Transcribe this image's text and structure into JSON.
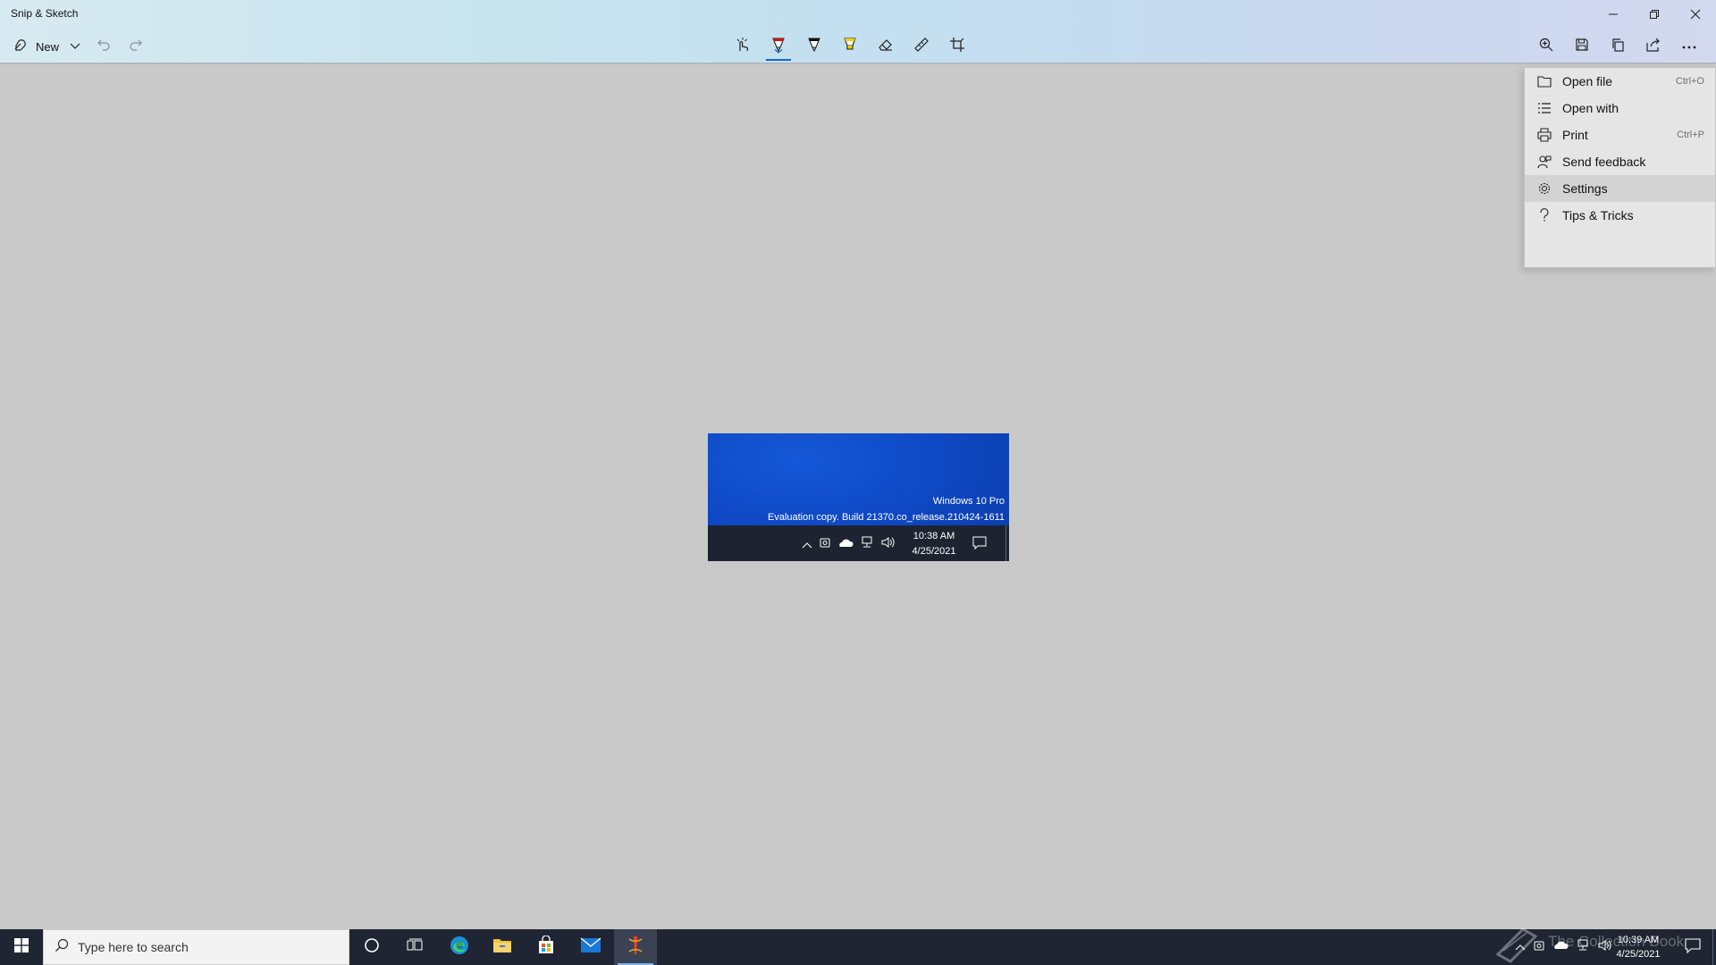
{
  "app": {
    "title": "Snip & Sketch"
  },
  "toolbar": {
    "new_label": "New",
    "left_icons": [
      "new-snip-icon",
      "chevron-down-icon",
      "undo-icon",
      "redo-icon"
    ],
    "center_tools": [
      "touch-writing-icon",
      "ballpoint-pen-icon",
      "pencil-icon",
      "highlighter-icon",
      "eraser-icon",
      "ruler-icon",
      "crop-icon"
    ],
    "right_tools": [
      "zoom-icon",
      "save-icon",
      "copy-icon",
      "share-icon",
      "more-icon"
    ],
    "pen_color": "#d21414",
    "highlighter_color": "#f2d000",
    "accent": "#1769c4"
  },
  "menu": {
    "items": [
      {
        "label": "Open file",
        "shortcut": "Ctrl+O",
        "icon": "folder-icon"
      },
      {
        "label": "Open with",
        "shortcut": "",
        "icon": "list-icon"
      },
      {
        "label": "Print",
        "shortcut": "Ctrl+P",
        "icon": "printer-icon"
      },
      {
        "label": "Send feedback",
        "shortcut": "",
        "icon": "feedback-icon"
      },
      {
        "label": "Settings",
        "shortcut": "",
        "icon": "gear-icon"
      },
      {
        "label": "Tips & Tricks",
        "shortcut": "",
        "icon": "question-icon"
      }
    ],
    "highlighted": "Settings"
  },
  "snip": {
    "edition": "Windows 10 Pro",
    "build": "Evaluation copy. Build 21370.co_release.210424-1611",
    "time": "10:38 AM",
    "date": "4/25/2021"
  },
  "taskbar": {
    "search_placeholder": "Type here to search",
    "apps": [
      "cortana-icon",
      "task-view-icon",
      "edge-icon",
      "file-explorer-icon",
      "store-icon",
      "mail-icon",
      "snip-sketch-icon"
    ],
    "active_app": "snip-sketch-icon",
    "time": "10:39 AM",
    "date": "4/25/2021"
  },
  "watermark": {
    "text": "The Collection Book"
  }
}
